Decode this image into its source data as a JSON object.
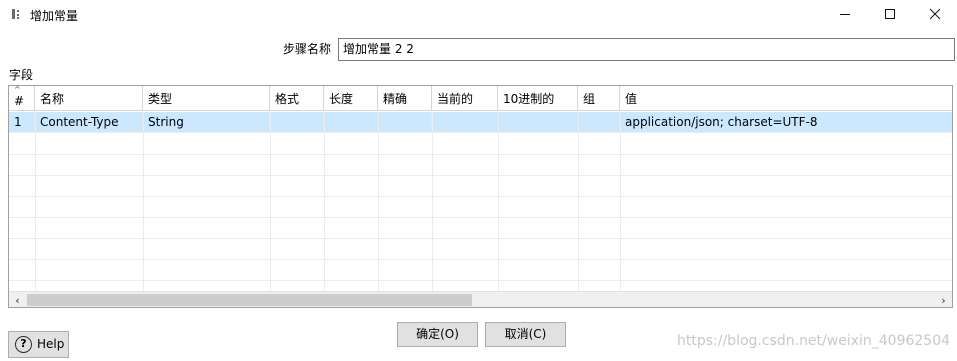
{
  "window": {
    "title": "增加常量",
    "icons": {
      "app": "kettle-step-icon",
      "minimize": "minimize-icon",
      "maximize": "maximize-icon",
      "close": "close-icon"
    }
  },
  "step": {
    "label": "步骤名称",
    "value": "增加常量 2 2"
  },
  "fields_label": "字段",
  "table": {
    "columns": [
      "#",
      "名称",
      "类型",
      "格式",
      "长度",
      "精确",
      "当前的",
      "10进制的",
      "组",
      "值"
    ],
    "rows": [
      [
        "1",
        "Content-Type",
        "String",
        "",
        "",
        "",
        "",
        "",
        "",
        "application/json; charset=UTF-8"
      ]
    ]
  },
  "buttons": {
    "ok": "确定(O)",
    "cancel": "取消(C)",
    "help": "Help"
  },
  "watermark": "https://blog.csdn.net/weixin_40962504"
}
